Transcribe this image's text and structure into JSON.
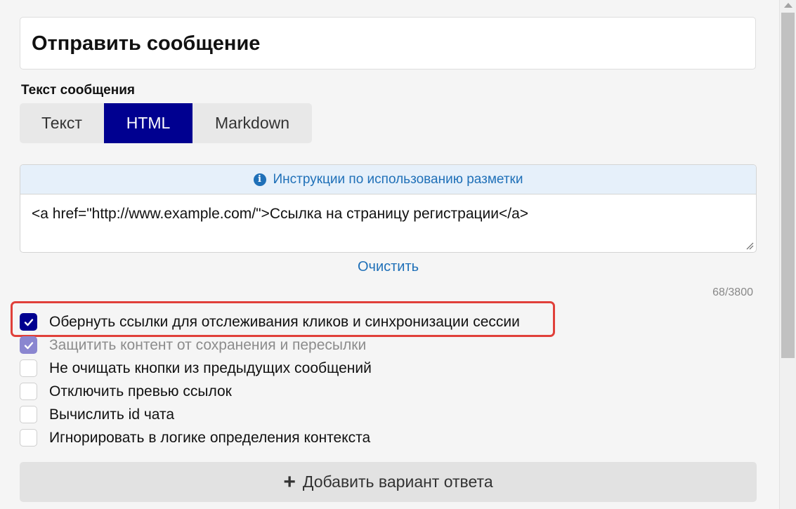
{
  "header": {
    "title": "Отправить сообщение"
  },
  "message": {
    "section_label": "Текст сообщения",
    "format_tabs": [
      {
        "label": "Текст",
        "active": false
      },
      {
        "label": "HTML",
        "active": true
      },
      {
        "label": "Markdown",
        "active": false
      }
    ],
    "instructions_link": "Инструкции по использованию разметки",
    "text_value": "<a href=\"http://www.example.com/\">Ссылка на страницу регистрации</a>",
    "clear_label": "Очистить",
    "char_counter": "68/3800"
  },
  "options": [
    {
      "label": "Обернуть ссылки для отслеживания кликов и синхронизации сессии",
      "checked": true,
      "disabled": false,
      "highlighted": true
    },
    {
      "label": "Защитить контент от сохранения и пересылки",
      "checked": true,
      "disabled": true
    },
    {
      "label": "Не очищать кнопки из предыдущих сообщений",
      "checked": false,
      "disabled": false
    },
    {
      "label": "Отключить превью ссылок",
      "checked": false,
      "disabled": false
    },
    {
      "label": "Вычислить id чата",
      "checked": false,
      "disabled": false
    },
    {
      "label": "Игнорировать в логике определения контекста",
      "checked": false,
      "disabled": false
    }
  ],
  "add_answer_button": {
    "label": "Добавить вариант ответа",
    "icon": "plus-icon"
  },
  "colors": {
    "accent": "#000090",
    "link": "#1f70b8",
    "highlight_border": "#e0403a",
    "disabled_check": "#8a86d0"
  }
}
